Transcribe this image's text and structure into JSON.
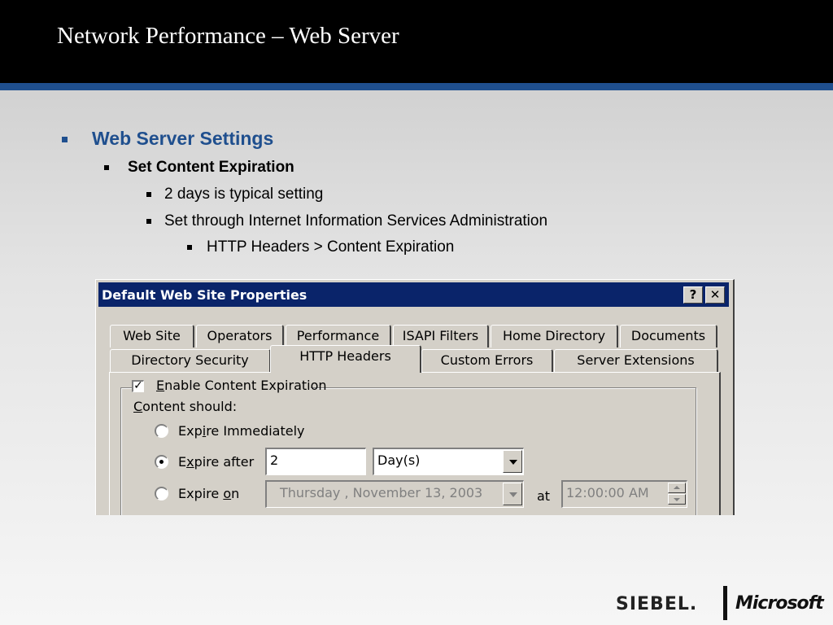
{
  "slide": {
    "title": "Network Performance – Web Server",
    "accent_color": "#1f4f8e",
    "bullets": {
      "level1": "Web Server Settings",
      "level2": "Set Content Expiration",
      "level3": [
        "2 days is typical setting",
        "Set through Internet Information Services Administration"
      ],
      "level4": "HTTP Headers > Content Expiration"
    }
  },
  "dialog": {
    "title": "Default Web Site Properties",
    "help_button": "?",
    "close_button": "✕",
    "tabs_row1": [
      "Web Site",
      "Operators",
      "Performance",
      "ISAPI Filters",
      "Home Directory",
      "Documents"
    ],
    "tabs_row2": [
      "Directory Security",
      "HTTP Headers",
      "Custom Errors",
      "Server Extensions"
    ],
    "active_tab": "HTTP Headers",
    "enable_expiration": {
      "checked": true,
      "check_mark": "✓",
      "label_accel": "E",
      "label_rest": "nable Content Expiration"
    },
    "content_should": {
      "accel": "C",
      "rest": "ontent should:"
    },
    "options": {
      "immediately": {
        "pre": "Exp",
        "accel": "i",
        "post": "re Immediately",
        "selected": false
      },
      "after": {
        "pre": "E",
        "accel": "x",
        "post": "pire after",
        "selected": true,
        "value": "2",
        "unit": "Day(s)"
      },
      "on": {
        "pre": "Expire ",
        "accel": "o",
        "post": "n",
        "selected": false,
        "date": "Thursday   , November 13, 2003",
        "at_label": "at",
        "time": "12:00:00 AM"
      }
    }
  },
  "logo": {
    "siebel": "SIEBEL.",
    "microsoft": "Microsoft"
  }
}
